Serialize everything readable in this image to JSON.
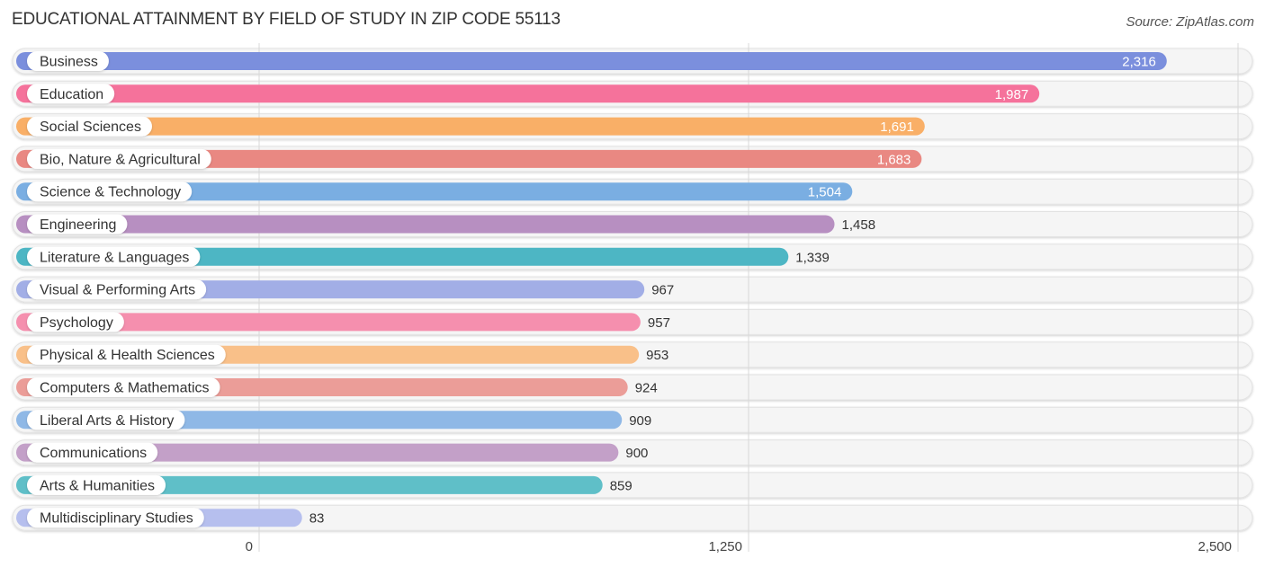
{
  "header": {
    "title": "EDUCATIONAL ATTAINMENT BY FIELD OF STUDY IN ZIP CODE 55113",
    "source": "Source: ZipAtlas.com"
  },
  "chart_data": {
    "type": "bar",
    "orientation": "horizontal",
    "title": "EDUCATIONAL ATTAINMENT BY FIELD OF STUDY IN ZIP CODE 55113",
    "xlabel": "",
    "ylabel": "",
    "xlim": [
      0,
      2500
    ],
    "ticks": [
      {
        "value": 0,
        "label": "0"
      },
      {
        "value": 1250,
        "label": "1,250"
      },
      {
        "value": 2500,
        "label": "2,500"
      }
    ],
    "grid": true,
    "categories": [
      "Business",
      "Education",
      "Social Sciences",
      "Bio, Nature & Agricultural",
      "Science & Technology",
      "Engineering",
      "Literature & Languages",
      "Visual & Performing Arts",
      "Psychology",
      "Physical & Health Sciences",
      "Computers & Mathematics",
      "Liberal Arts & History",
      "Communications",
      "Arts & Humanities",
      "Multidisciplinary Studies"
    ],
    "values": [
      2316,
      1987,
      1691,
      1683,
      1504,
      1458,
      1339,
      967,
      957,
      953,
      924,
      909,
      900,
      859,
      83
    ],
    "value_labels": [
      "2,316",
      "1,987",
      "1,691",
      "1,683",
      "1,504",
      "1,458",
      "1,339",
      "967",
      "957",
      "953",
      "924",
      "909",
      "900",
      "859",
      "83"
    ],
    "colors": [
      "#7b8fdd",
      "#f5729b",
      "#f9af67",
      "#e98882",
      "#7aaee2",
      "#b78fc1",
      "#4db6c4",
      "#a2aee6",
      "#f58fae",
      "#f9c089",
      "#eb9d98",
      "#8fb8e6",
      "#c3a0c8",
      "#5fbfc8",
      "#b6bfee"
    ]
  }
}
